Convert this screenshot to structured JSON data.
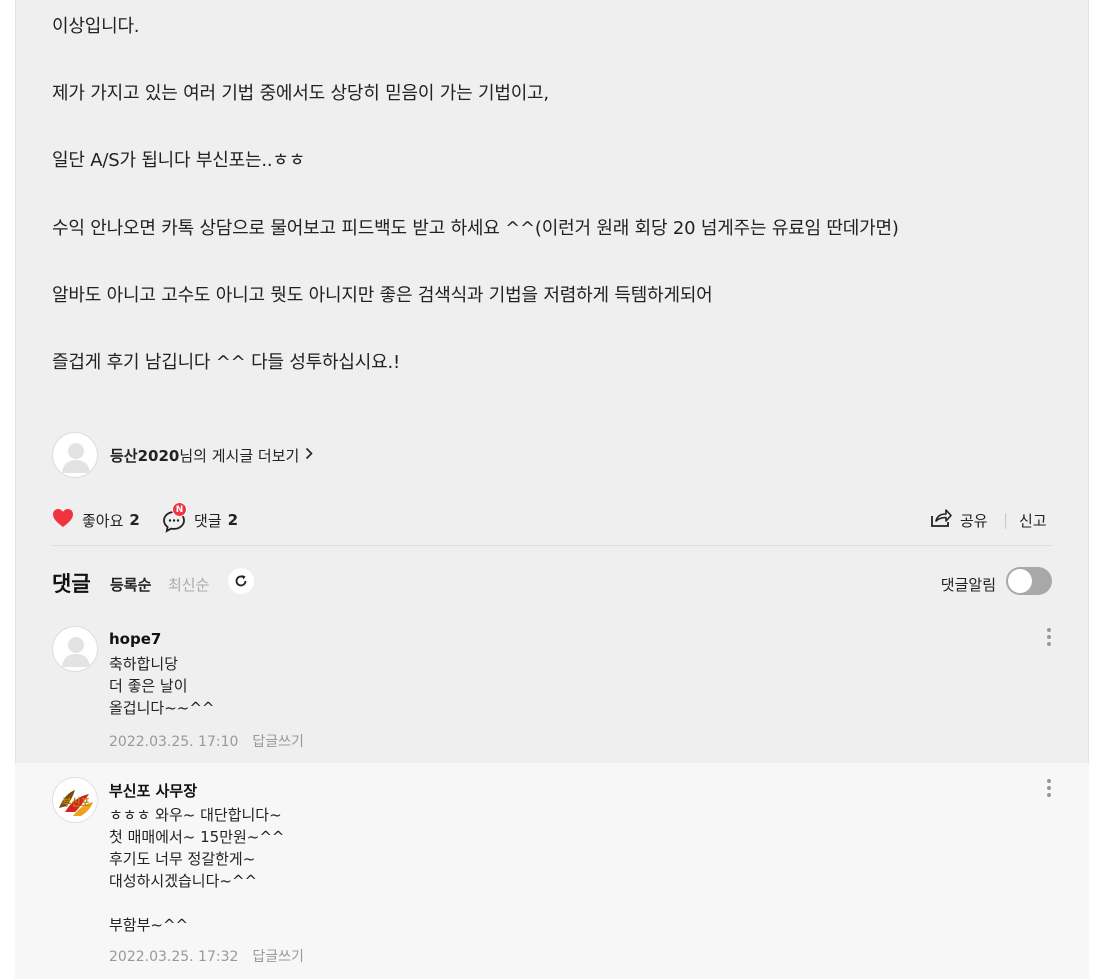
{
  "post": {
    "paragraphs": [
      "이상입니다.",
      "제가 가지고 있는 여러 기법 중에서도 상당히 믿음이 가는 기법이고,",
      "일단 A/S가 됩니다 부신포는..ㅎㅎ",
      "수익 안나오면 카톡 상담으로 물어보고 피드백도 받고 하세요 ^^(이런거 원래 회당 20 넘게주는 유료임 딴데가면)",
      "알바도 아니고 고수도 아니고 뭣도 아니지만 좋은 검색식과 기법을 저렴하게 득템하게되어",
      "즐겁게 후기 남깁니다 ^^ 다들 성투하십시요.!"
    ]
  },
  "author": {
    "name": "등산2020",
    "more_text": "님의 게시글 더보기"
  },
  "actions": {
    "like_label": "좋아요",
    "like_count": "2",
    "comment_label": "댓글",
    "comment_count": "2",
    "new_badge": "N",
    "share_label": "공유",
    "separator": "|",
    "report_label": "신고"
  },
  "comments_header": {
    "title": "댓글",
    "sort_registered": "등록순",
    "sort_latest": "최신순",
    "notification_label": "댓글알림"
  },
  "comments": [
    {
      "author": "hope7",
      "body": "축하합니당\n더 좋은 날이\n올겁니다~~^^",
      "date": "2022.03.25. 17:10",
      "reply_label": "답글쓰기"
    },
    {
      "author": "부신포 사무장",
      "body": "ㅎㅎㅎ 와우~ 대단합니다~\n첫 매매에서~ 15만원~^^\n후기도 너무 정갈한게~\n대성하시겠습니다~^^\n\n부함부~^^",
      "date": "2022.03.25. 17:32",
      "reply_label": "답글쓰기",
      "avatar_logo_text": "부신포"
    }
  ],
  "colors": {
    "background": "#efefef",
    "heart": "#f0343f",
    "badge": "#f0343f",
    "toggle_off": "#a8a8a8"
  }
}
